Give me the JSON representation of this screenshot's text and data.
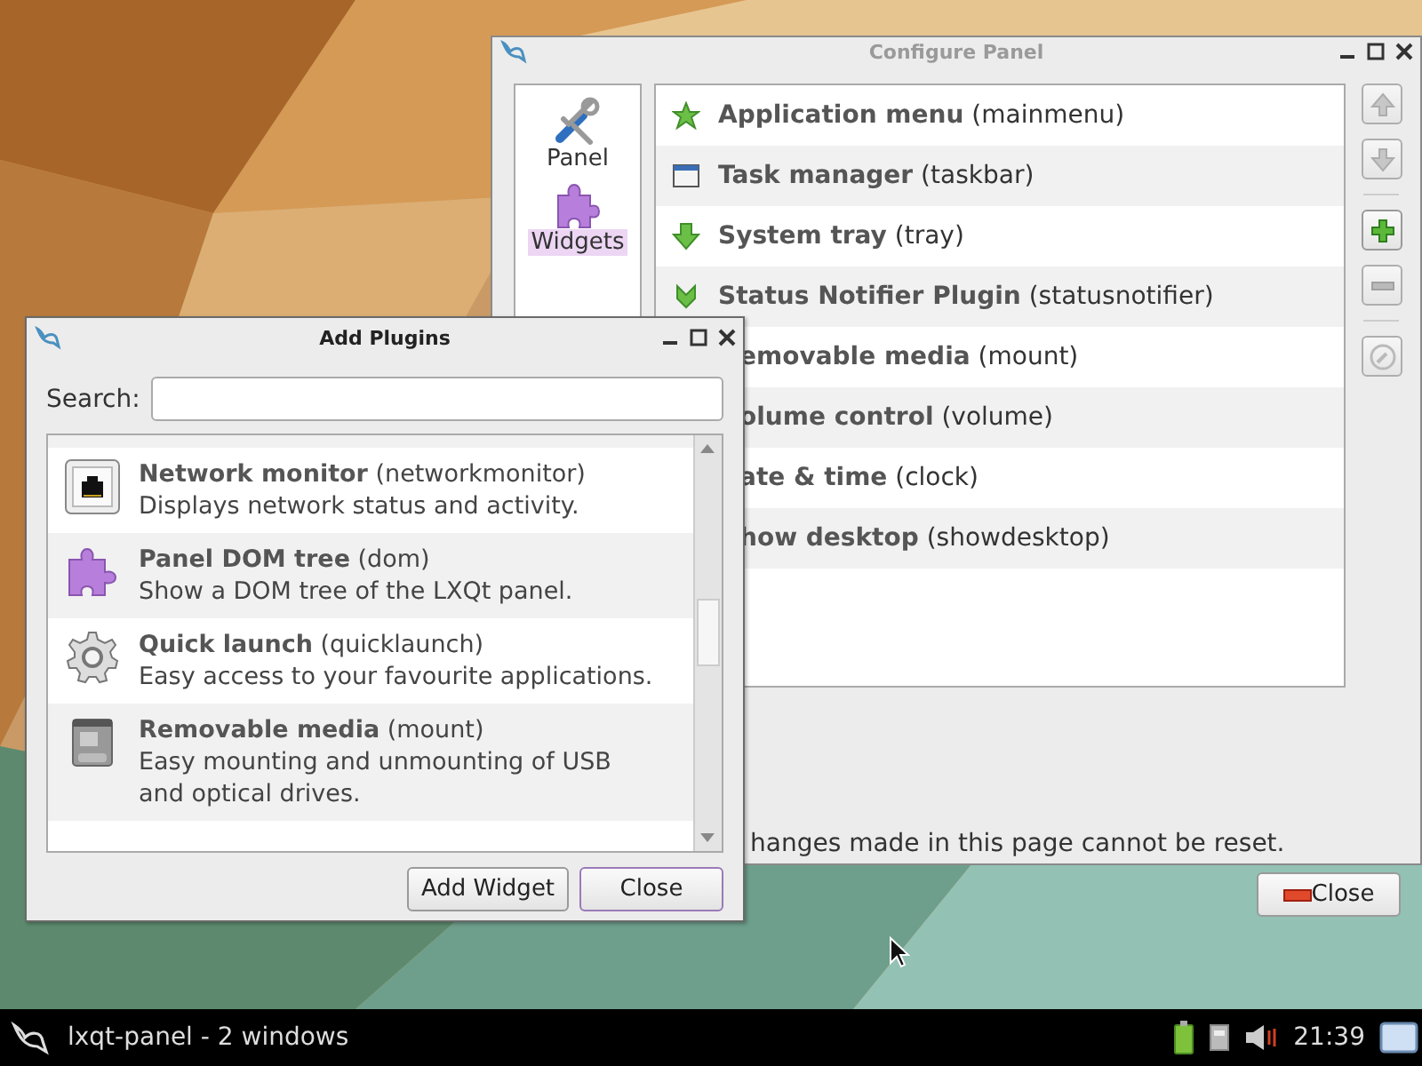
{
  "configure_panel": {
    "title": "Configure Panel",
    "sidebar": [
      {
        "label": "Panel",
        "selected": false
      },
      {
        "label": "Widgets",
        "selected": true
      }
    ],
    "widgets": [
      {
        "kind": "full",
        "name": "Application menu",
        "id": "(mainmenu)"
      },
      {
        "kind": "full",
        "name": "Task manager",
        "id": "(taskbar)"
      },
      {
        "kind": "full",
        "name": "System tray",
        "id": "(tray)"
      },
      {
        "kind": "full",
        "name": "Status Notifier Plugin",
        "id": "(statusnotifier)"
      },
      {
        "kind": "clipped",
        "name": "emovable media",
        "id": "(mount)"
      },
      {
        "kind": "clipped",
        "name": "olume control",
        "id": "(volume)"
      },
      {
        "kind": "clipped",
        "name": "ate & time",
        "id": "(clock)"
      },
      {
        "kind": "clipped",
        "name": "how desktop",
        "id": "(showdesktop)"
      }
    ],
    "side_buttons": [
      {
        "kind": "up",
        "disabled": true
      },
      {
        "kind": "down",
        "disabled": true
      },
      {
        "kind": "add",
        "disabled": false
      },
      {
        "kind": "remove",
        "disabled": true
      },
      {
        "kind": "configure",
        "disabled": true
      }
    ],
    "note": "hanges made in this page cannot be reset.",
    "close_button": "Close"
  },
  "add_plugins": {
    "title": "Add Plugins",
    "search_label": "Search:",
    "plugins": [
      {
        "name": "Network monitor",
        "id": "(networkmonitor)",
        "description": "Displays network status and activity."
      },
      {
        "name": "Panel DOM tree",
        "id": "(dom)",
        "description": "Show a DOM tree of the LXQt panel."
      },
      {
        "name": "Quick launch",
        "id": "(quicklaunch)",
        "description": "Easy access to your favourite applications."
      },
      {
        "name": "Removable media",
        "id": "(mount)",
        "description": "Easy mounting and unmounting of USB and optical drives."
      }
    ],
    "buttons": [
      {
        "label": "Add Widget",
        "focused": false
      },
      {
        "label": "Close",
        "focused": true
      }
    ]
  },
  "taskbar": {
    "task": "lxqt-panel - 2 windows",
    "clock": "21:39"
  }
}
